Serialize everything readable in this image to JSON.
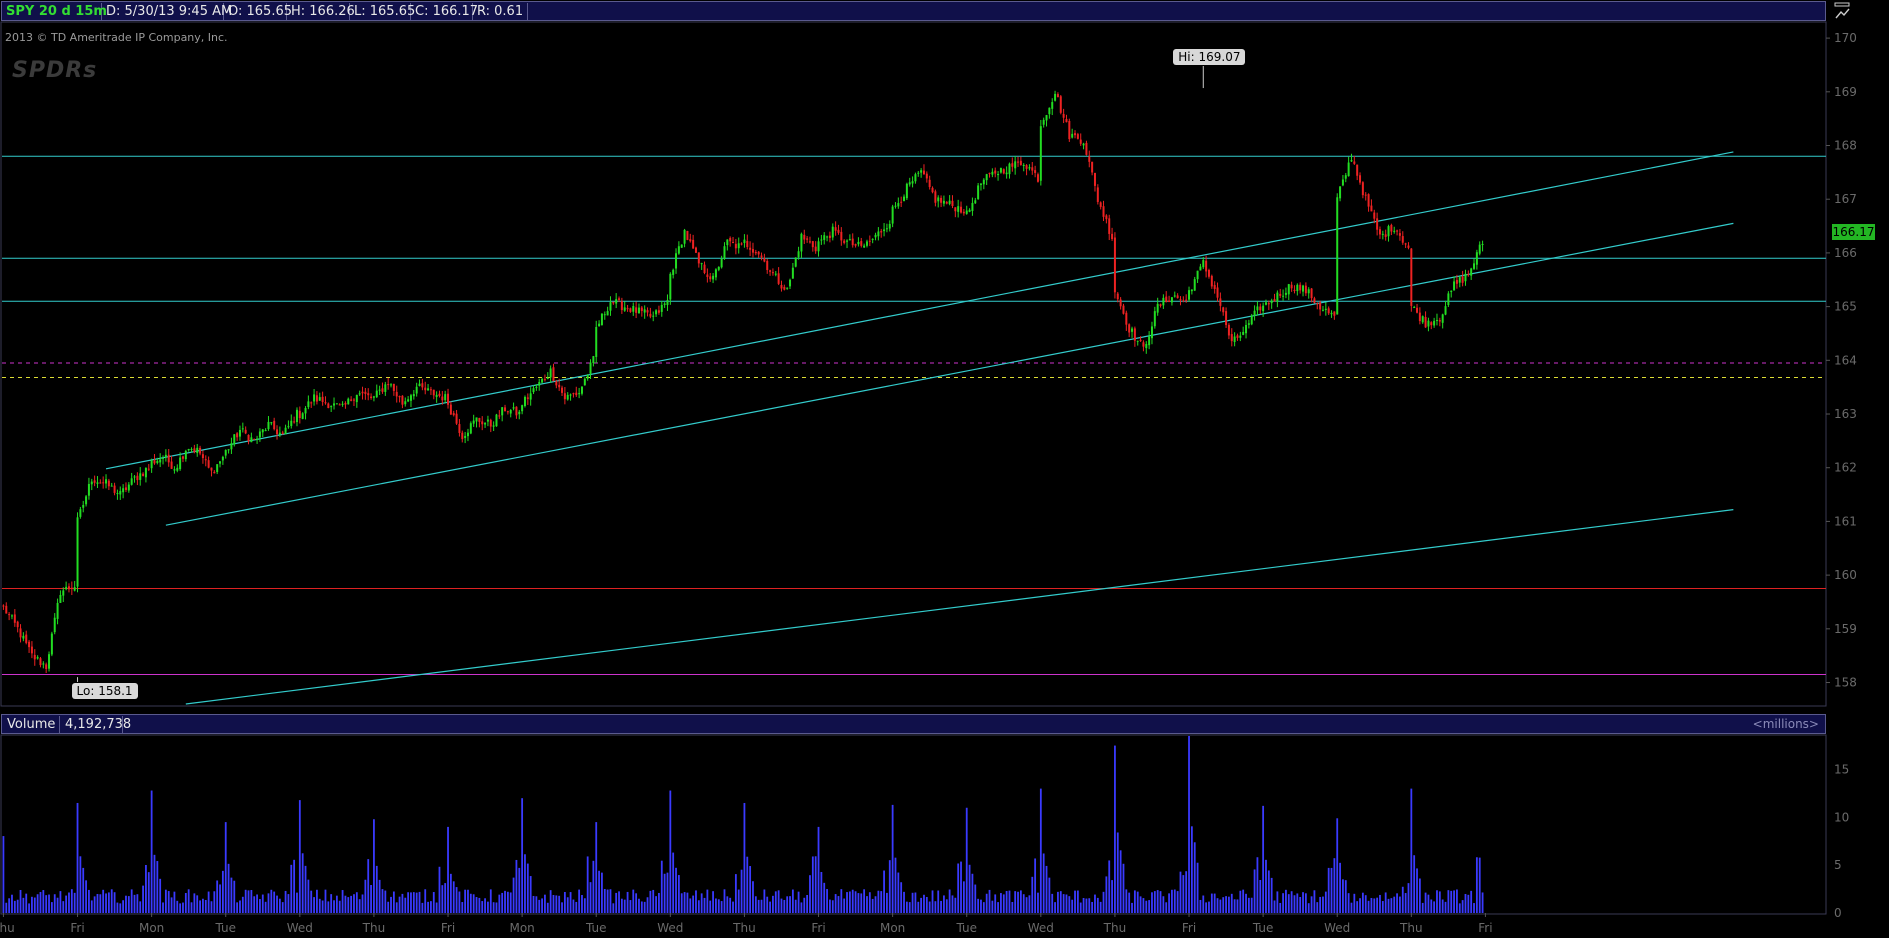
{
  "header": {
    "symbol": "SPY 20 d 15m",
    "date": "D: 5/30/13 9:45 AM",
    "open": "O: 165.65",
    "high": "H: 166.26",
    "low": "L: 165.65",
    "close": "C: 166.17",
    "range": "R: 0.61"
  },
  "credit": "2013 © TD Ameritrade IP Company, Inc.",
  "logo": "SPDRs",
  "current_price_label": "166.17",
  "hi_label": "Hi: 169.07",
  "lo_label": "Lo: 158.1",
  "volume_panel": {
    "title": "Volume",
    "value": "4,192,738",
    "unit": "<millions>"
  },
  "colors": {
    "up_candle": "#22dd22",
    "down_candle": "#ee2222",
    "trendline": "#33cccc",
    "volume_bar": "#3a3aff",
    "magenta_line": "#cc33cc",
    "red_line": "#dd2222",
    "dashed_magenta": "#cc33cc",
    "dashed_yellow": "#dddd33"
  },
  "chart_data": {
    "type": "candlestick",
    "price_axis": {
      "ylim": [
        157.6,
        170.3
      ],
      "ticks": [
        158,
        159,
        160,
        161,
        162,
        163,
        164,
        165,
        166,
        167,
        168,
        169,
        170
      ]
    },
    "volume_axis": {
      "ylim": [
        0,
        18.5
      ],
      "ticks": [
        0,
        5,
        10,
        15
      ],
      "unit": "millions"
    },
    "x_labels": [
      "Thu",
      "Fri",
      "Mon",
      "Tue",
      "Wed",
      "Thu",
      "Fri",
      "Mon",
      "Tue",
      "Wed",
      "Thu",
      "Fri",
      "Mon",
      "Tue",
      "Wed",
      "Thu",
      "Fri",
      "Tue",
      "Wed",
      "Thu",
      "Fri"
    ],
    "label_bars": [
      0,
      26,
      52,
      78,
      104,
      130,
      156,
      182,
      208,
      234,
      260,
      286,
      312,
      338,
      364,
      390,
      416,
      442,
      468,
      494,
      520
    ],
    "bars_visible": 520,
    "daily_path": [
      [
        159.4,
        159.0,
        158.5,
        158.3,
        159.7,
        159.8
      ],
      [
        161.0,
        161.8,
        161.7,
        161.5,
        161.8,
        162.0
      ],
      [
        162.1,
        162.2,
        162.0,
        162.4,
        162.3,
        161.9,
        162.2
      ],
      [
        162.3,
        162.7,
        162.5,
        162.8,
        162.6,
        163.0
      ],
      [
        163.0,
        163.3,
        163.2,
        163.1,
        163.4,
        163.3
      ],
      [
        163.3,
        163.6,
        163.2,
        163.5,
        163.4,
        163.3
      ],
      [
        163.2,
        162.6,
        162.9,
        162.8,
        163.1,
        163.0
      ],
      [
        163.2,
        163.5,
        163.8,
        163.3,
        163.4,
        164.0
      ],
      [
        164.6,
        165.1,
        165.0,
        164.9,
        164.8,
        165.1
      ],
      [
        165.6,
        166.4,
        165.8,
        165.5,
        166.2,
        166.1
      ],
      [
        166.2,
        166.0,
        165.6,
        165.3,
        166.3,
        166.1
      ],
      [
        166.2,
        166.4,
        166.2,
        166.1,
        166.3,
        166.6
      ],
      [
        166.8,
        167.2,
        167.5,
        167.0,
        166.9,
        166.8
      ],
      [
        166.7,
        167.3,
        167.5,
        167.6,
        167.7,
        167.4
      ],
      [
        168.4,
        169.0,
        168.2,
        168.1,
        167.0,
        166.3
      ],
      [
        165.3,
        164.6,
        164.2,
        165.0,
        165.2,
        165.1
      ],
      [
        165.3,
        165.8,
        165.2,
        164.3,
        164.6,
        165.0
      ],
      [
        165.0,
        165.2,
        165.4,
        165.3,
        165.0,
        164.8
      ],
      [
        167.0,
        167.8,
        167.0,
        166.3,
        166.5,
        166.1
      ],
      [
        165.0,
        164.7,
        164.8,
        165.4,
        165.6,
        166.2
      ]
    ],
    "horizontal_lines": [
      {
        "y": 167.8,
        "style": "solid",
        "color": "trendline"
      },
      {
        "y": 165.9,
        "style": "solid",
        "color": "trendline"
      },
      {
        "y": 165.1,
        "style": "solid",
        "color": "trendline"
      },
      {
        "y": 163.95,
        "style": "dashed",
        "color": "dashed_magenta"
      },
      {
        "y": 163.68,
        "style": "dashed",
        "color": "dashed_yellow"
      },
      {
        "y": 159.75,
        "style": "solid",
        "color": "red_line"
      },
      {
        "y": 158.15,
        "style": "solid",
        "color": "magenta_line"
      }
    ],
    "trend_lines": [
      {
        "from": [
          36,
          161.98
        ],
        "to": [
          607,
          167.88
        ]
      },
      {
        "from": [
          57,
          160.93
        ],
        "to": [
          607,
          166.55
        ]
      },
      {
        "from": [
          64,
          157.6
        ],
        "to": [
          607,
          161.22
        ]
      }
    ],
    "hi": {
      "bar": 421,
      "value": 169.07
    },
    "lo": {
      "bar": 26,
      "value": 158.1
    },
    "volume_peaks": {
      "day_open_bars": [
        26,
        52,
        78,
        104,
        130,
        156,
        182,
        208,
        234,
        260,
        286,
        312,
        338,
        364,
        390,
        416,
        442,
        468,
        494
      ],
      "peak_values": [
        11.5,
        12.8,
        9.5,
        11.8,
        9.8,
        9.0,
        12.0,
        9.5,
        12.8,
        11.5,
        9.0,
        11.3,
        11.0,
        13.0,
        17.5,
        18.5,
        11.2,
        9.9,
        13.0
      ]
    }
  }
}
